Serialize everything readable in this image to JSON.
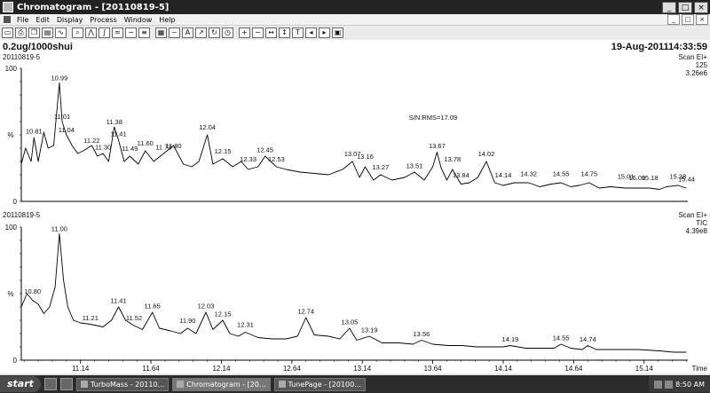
{
  "window": {
    "title": "Chromatogram - [20110819-5]",
    "controls": [
      "_",
      "□",
      "×"
    ]
  },
  "menu": [
    "File",
    "Edit",
    "Display",
    "Process",
    "Window",
    "Help"
  ],
  "toolbar_icons": [
    "open-icon",
    "print-icon",
    "copy-icon",
    "paste-icon",
    "chart-icon",
    "zoom-icon",
    "peak-icon",
    "integrate-icon",
    "smooth-icon",
    "subtract-icon",
    "list-icon",
    "report-icon",
    "noise-icon",
    "text-icon",
    "arrow-icon",
    "refresh-icon",
    "clock-icon",
    "zoom-in-icon",
    "zoom-out-icon",
    "zoom-x-icon",
    "zoom-y-icon",
    "tic-icon",
    "left-icon",
    "right-icon",
    "fit-icon"
  ],
  "header": {
    "sample": "0.2ug/1000shui",
    "date": "19-Aug-201114:33:59"
  },
  "chart_data": [
    {
      "type": "line",
      "file_label": "20110819-5",
      "scan": "Scan EI+",
      "ion": "125",
      "intensity": "3.26e6",
      "ylabel": "%",
      "yticks": [
        "100",
        "0"
      ],
      "ylim": [
        0,
        100
      ],
      "xlim": [
        10.72,
        15.45
      ],
      "annotation": "S/N:RMS=17.09",
      "points": [
        [
          10.72,
          28
        ],
        [
          10.75,
          40
        ],
        [
          10.79,
          30
        ],
        [
          10.81,
          48
        ],
        [
          10.84,
          30
        ],
        [
          10.88,
          52
        ],
        [
          10.91,
          40
        ],
        [
          10.95,
          42
        ],
        [
          10.99,
          89
        ],
        [
          11.01,
          60
        ],
        [
          11.04,
          50
        ],
        [
          11.08,
          42
        ],
        [
          11.12,
          36
        ],
        [
          11.16,
          38
        ],
        [
          11.22,
          42
        ],
        [
          11.26,
          34
        ],
        [
          11.3,
          36
        ],
        [
          11.34,
          30
        ],
        [
          11.38,
          56
        ],
        [
          11.41,
          46
        ],
        [
          11.45,
          30
        ],
        [
          11.49,
          34
        ],
        [
          11.55,
          28
        ],
        [
          11.6,
          38
        ],
        [
          11.66,
          30
        ],
        [
          11.73,
          36
        ],
        [
          11.8,
          42
        ],
        [
          11.87,
          28
        ],
        [
          11.93,
          26
        ],
        [
          11.98,
          30
        ],
        [
          12.04,
          50
        ],
        [
          12.08,
          28
        ],
        [
          12.15,
          32
        ],
        [
          12.22,
          26
        ],
        [
          12.28,
          30
        ],
        [
          12.33,
          24
        ],
        [
          12.4,
          26
        ],
        [
          12.45,
          34
        ],
        [
          12.53,
          26
        ],
        [
          12.6,
          24
        ],
        [
          12.7,
          22
        ],
        [
          12.8,
          21
        ],
        [
          12.9,
          20
        ],
        [
          13.0,
          24
        ],
        [
          13.07,
          30
        ],
        [
          13.12,
          18
        ],
        [
          13.16,
          26
        ],
        [
          13.22,
          16
        ],
        [
          13.27,
          20
        ],
        [
          13.35,
          16
        ],
        [
          13.44,
          18
        ],
        [
          13.51,
          22
        ],
        [
          13.58,
          16
        ],
        [
          13.64,
          26
        ],
        [
          13.67,
          37
        ],
        [
          13.7,
          25
        ],
        [
          13.74,
          16
        ],
        [
          13.78,
          24
        ],
        [
          13.84,
          13
        ],
        [
          13.9,
          14
        ],
        [
          13.96,
          18
        ],
        [
          14.02,
          30
        ],
        [
          14.08,
          14
        ],
        [
          14.14,
          12
        ],
        [
          14.22,
          14
        ],
        [
          14.32,
          14
        ],
        [
          14.4,
          11
        ],
        [
          14.48,
          13
        ],
        [
          14.55,
          14
        ],
        [
          14.62,
          11
        ],
        [
          14.68,
          12
        ],
        [
          14.75,
          14
        ],
        [
          14.82,
          10
        ],
        [
          14.9,
          11
        ],
        [
          15.01,
          10
        ],
        [
          15.09,
          10
        ],
        [
          15.18,
          10
        ],
        [
          15.25,
          9
        ],
        [
          15.3,
          11
        ],
        [
          15.38,
          12
        ],
        [
          15.44,
          10
        ]
      ],
      "peak_labels": [
        {
          "x": 10.81,
          "y": 49,
          "label": "10.81"
        },
        {
          "x": 10.99,
          "y": 89,
          "label": "10.99"
        },
        {
          "x": 11.01,
          "y": 60,
          "label": "11.01"
        },
        {
          "x": 11.04,
          "y": 50,
          "label": "11.04"
        },
        {
          "x": 11.22,
          "y": 42,
          "label": "11.22"
        },
        {
          "x": 11.3,
          "y": 37,
          "label": "11.30"
        },
        {
          "x": 11.38,
          "y": 56,
          "label": "11.38"
        },
        {
          "x": 11.41,
          "y": 47,
          "label": "11.41"
        },
        {
          "x": 11.49,
          "y": 36,
          "label": "11.49"
        },
        {
          "x": 11.6,
          "y": 40,
          "label": "11.60"
        },
        {
          "x": 11.73,
          "y": 37,
          "label": "11.73"
        },
        {
          "x": 11.8,
          "y": 38,
          "label": "11.80"
        },
        {
          "x": 12.04,
          "y": 52,
          "label": "12.04"
        },
        {
          "x": 12.15,
          "y": 34,
          "label": "12.15"
        },
        {
          "x": 12.33,
          "y": 28,
          "label": "12.33"
        },
        {
          "x": 12.45,
          "y": 35,
          "label": "12.45"
        },
        {
          "x": 12.53,
          "y": 28,
          "label": "12.53"
        },
        {
          "x": 13.07,
          "y": 32,
          "label": "13.07"
        },
        {
          "x": 13.16,
          "y": 30,
          "label": "13.16"
        },
        {
          "x": 13.27,
          "y": 22,
          "label": "13.27"
        },
        {
          "x": 13.51,
          "y": 23,
          "label": "13.51"
        },
        {
          "x": 13.67,
          "y": 38,
          "label": "13.67"
        },
        {
          "x": 13.78,
          "y": 28,
          "label": "13.78"
        },
        {
          "x": 13.84,
          "y": 16,
          "label": "13.84"
        },
        {
          "x": 14.02,
          "y": 32,
          "label": "14.02"
        },
        {
          "x": 14.14,
          "y": 16,
          "label": "14.14"
        },
        {
          "x": 14.32,
          "y": 17,
          "label": "14.32"
        },
        {
          "x": 14.55,
          "y": 17,
          "label": "14.55"
        },
        {
          "x": 14.75,
          "y": 17,
          "label": "14.75"
        },
        {
          "x": 15.01,
          "y": 15,
          "label": "15.01"
        },
        {
          "x": 15.09,
          "y": 14,
          "label": "15.09"
        },
        {
          "x": 15.18,
          "y": 14,
          "label": "15.18"
        },
        {
          "x": 15.38,
          "y": 15,
          "label": "15.38"
        },
        {
          "x": 15.44,
          "y": 13,
          "label": "15.44"
        }
      ]
    },
    {
      "type": "line",
      "file_label": "20110819-5",
      "scan": "Scan EI+",
      "ion": "TIC",
      "intensity": "4.39e8",
      "ylabel": "%",
      "yticks": [
        "100",
        "0"
      ],
      "ylim": [
        0,
        100
      ],
      "xlim": [
        10.72,
        15.45
      ],
      "xlabel": "Time",
      "xticks": [
        "11.14",
        "11.64",
        "12.14",
        "12.64",
        "13.14",
        "13.64",
        "14.14",
        "14.64",
        "15.14"
      ],
      "points": [
        [
          10.72,
          40
        ],
        [
          10.76,
          50
        ],
        [
          10.8,
          45
        ],
        [
          10.84,
          42
        ],
        [
          10.88,
          35
        ],
        [
          10.92,
          40
        ],
        [
          10.96,
          55
        ],
        [
          10.99,
          95
        ],
        [
          11.02,
          60
        ],
        [
          11.05,
          40
        ],
        [
          11.09,
          30
        ],
        [
          11.14,
          28
        ],
        [
          11.21,
          27
        ],
        [
          11.3,
          25
        ],
        [
          11.36,
          30
        ],
        [
          11.41,
          40
        ],
        [
          11.46,
          30
        ],
        [
          11.52,
          26
        ],
        [
          11.58,
          23
        ],
        [
          11.65,
          36
        ],
        [
          11.7,
          24
        ],
        [
          11.78,
          22
        ],
        [
          11.85,
          20
        ],
        [
          11.9,
          24
        ],
        [
          11.96,
          20
        ],
        [
          12.03,
          36
        ],
        [
          12.08,
          23
        ],
        [
          12.15,
          30
        ],
        [
          12.2,
          20
        ],
        [
          12.26,
          18
        ],
        [
          12.31,
          21
        ],
        [
          12.4,
          17
        ],
        [
          12.5,
          16
        ],
        [
          12.6,
          16
        ],
        [
          12.68,
          18
        ],
        [
          12.74,
          32
        ],
        [
          12.8,
          19
        ],
        [
          12.9,
          18
        ],
        [
          12.98,
          16
        ],
        [
          13.05,
          24
        ],
        [
          13.1,
          15
        ],
        [
          13.19,
          18
        ],
        [
          13.28,
          13
        ],
        [
          13.4,
          13
        ],
        [
          13.5,
          12
        ],
        [
          13.56,
          15
        ],
        [
          13.64,
          12
        ],
        [
          13.75,
          11
        ],
        [
          13.85,
          11
        ],
        [
          13.95,
          10
        ],
        [
          14.05,
          10
        ],
        [
          14.14,
          10
        ],
        [
          14.19,
          11
        ],
        [
          14.3,
          9
        ],
        [
          14.4,
          9
        ],
        [
          14.5,
          9
        ],
        [
          14.55,
          12
        ],
        [
          14.62,
          9
        ],
        [
          14.7,
          8
        ],
        [
          14.74,
          11
        ],
        [
          14.8,
          8
        ],
        [
          14.95,
          8
        ],
        [
          15.1,
          8
        ],
        [
          15.25,
          7
        ],
        [
          15.35,
          6
        ],
        [
          15.44,
          6
        ]
      ],
      "peak_labels": [
        {
          "x": 10.8,
          "y": 48,
          "label": "10.80"
        },
        {
          "x": 10.99,
          "y": 95,
          "label": "11.00"
        },
        {
          "x": 11.21,
          "y": 28,
          "label": "11.21"
        },
        {
          "x": 11.41,
          "y": 41,
          "label": "11.41"
        },
        {
          "x": 11.52,
          "y": 28,
          "label": "11.52"
        },
        {
          "x": 11.65,
          "y": 37,
          "label": "11.65"
        },
        {
          "x": 11.9,
          "y": 26,
          "label": "11.90"
        },
        {
          "x": 12.03,
          "y": 37,
          "label": "12.03"
        },
        {
          "x": 12.15,
          "y": 31,
          "label": "12.15"
        },
        {
          "x": 12.31,
          "y": 23,
          "label": "12.31"
        },
        {
          "x": 12.74,
          "y": 33,
          "label": "12.74"
        },
        {
          "x": 13.05,
          "y": 25,
          "label": "13.05"
        },
        {
          "x": 13.19,
          "y": 19,
          "label": "13.19"
        },
        {
          "x": 13.56,
          "y": 16,
          "label": "13.56"
        },
        {
          "x": 14.19,
          "y": 12,
          "label": "14.19"
        },
        {
          "x": 14.55,
          "y": 13,
          "label": "14.55"
        },
        {
          "x": 14.74,
          "y": 12,
          "label": "14.74"
        }
      ]
    }
  ],
  "taskbar": {
    "start": "start",
    "tasks": [
      {
        "label": "TurboMass - 20110...",
        "active": false
      },
      {
        "label": "Chromatogram - [20...",
        "active": true
      },
      {
        "label": "TunePage - [20100...",
        "active": false
      }
    ],
    "clock": "8:50 AM"
  }
}
